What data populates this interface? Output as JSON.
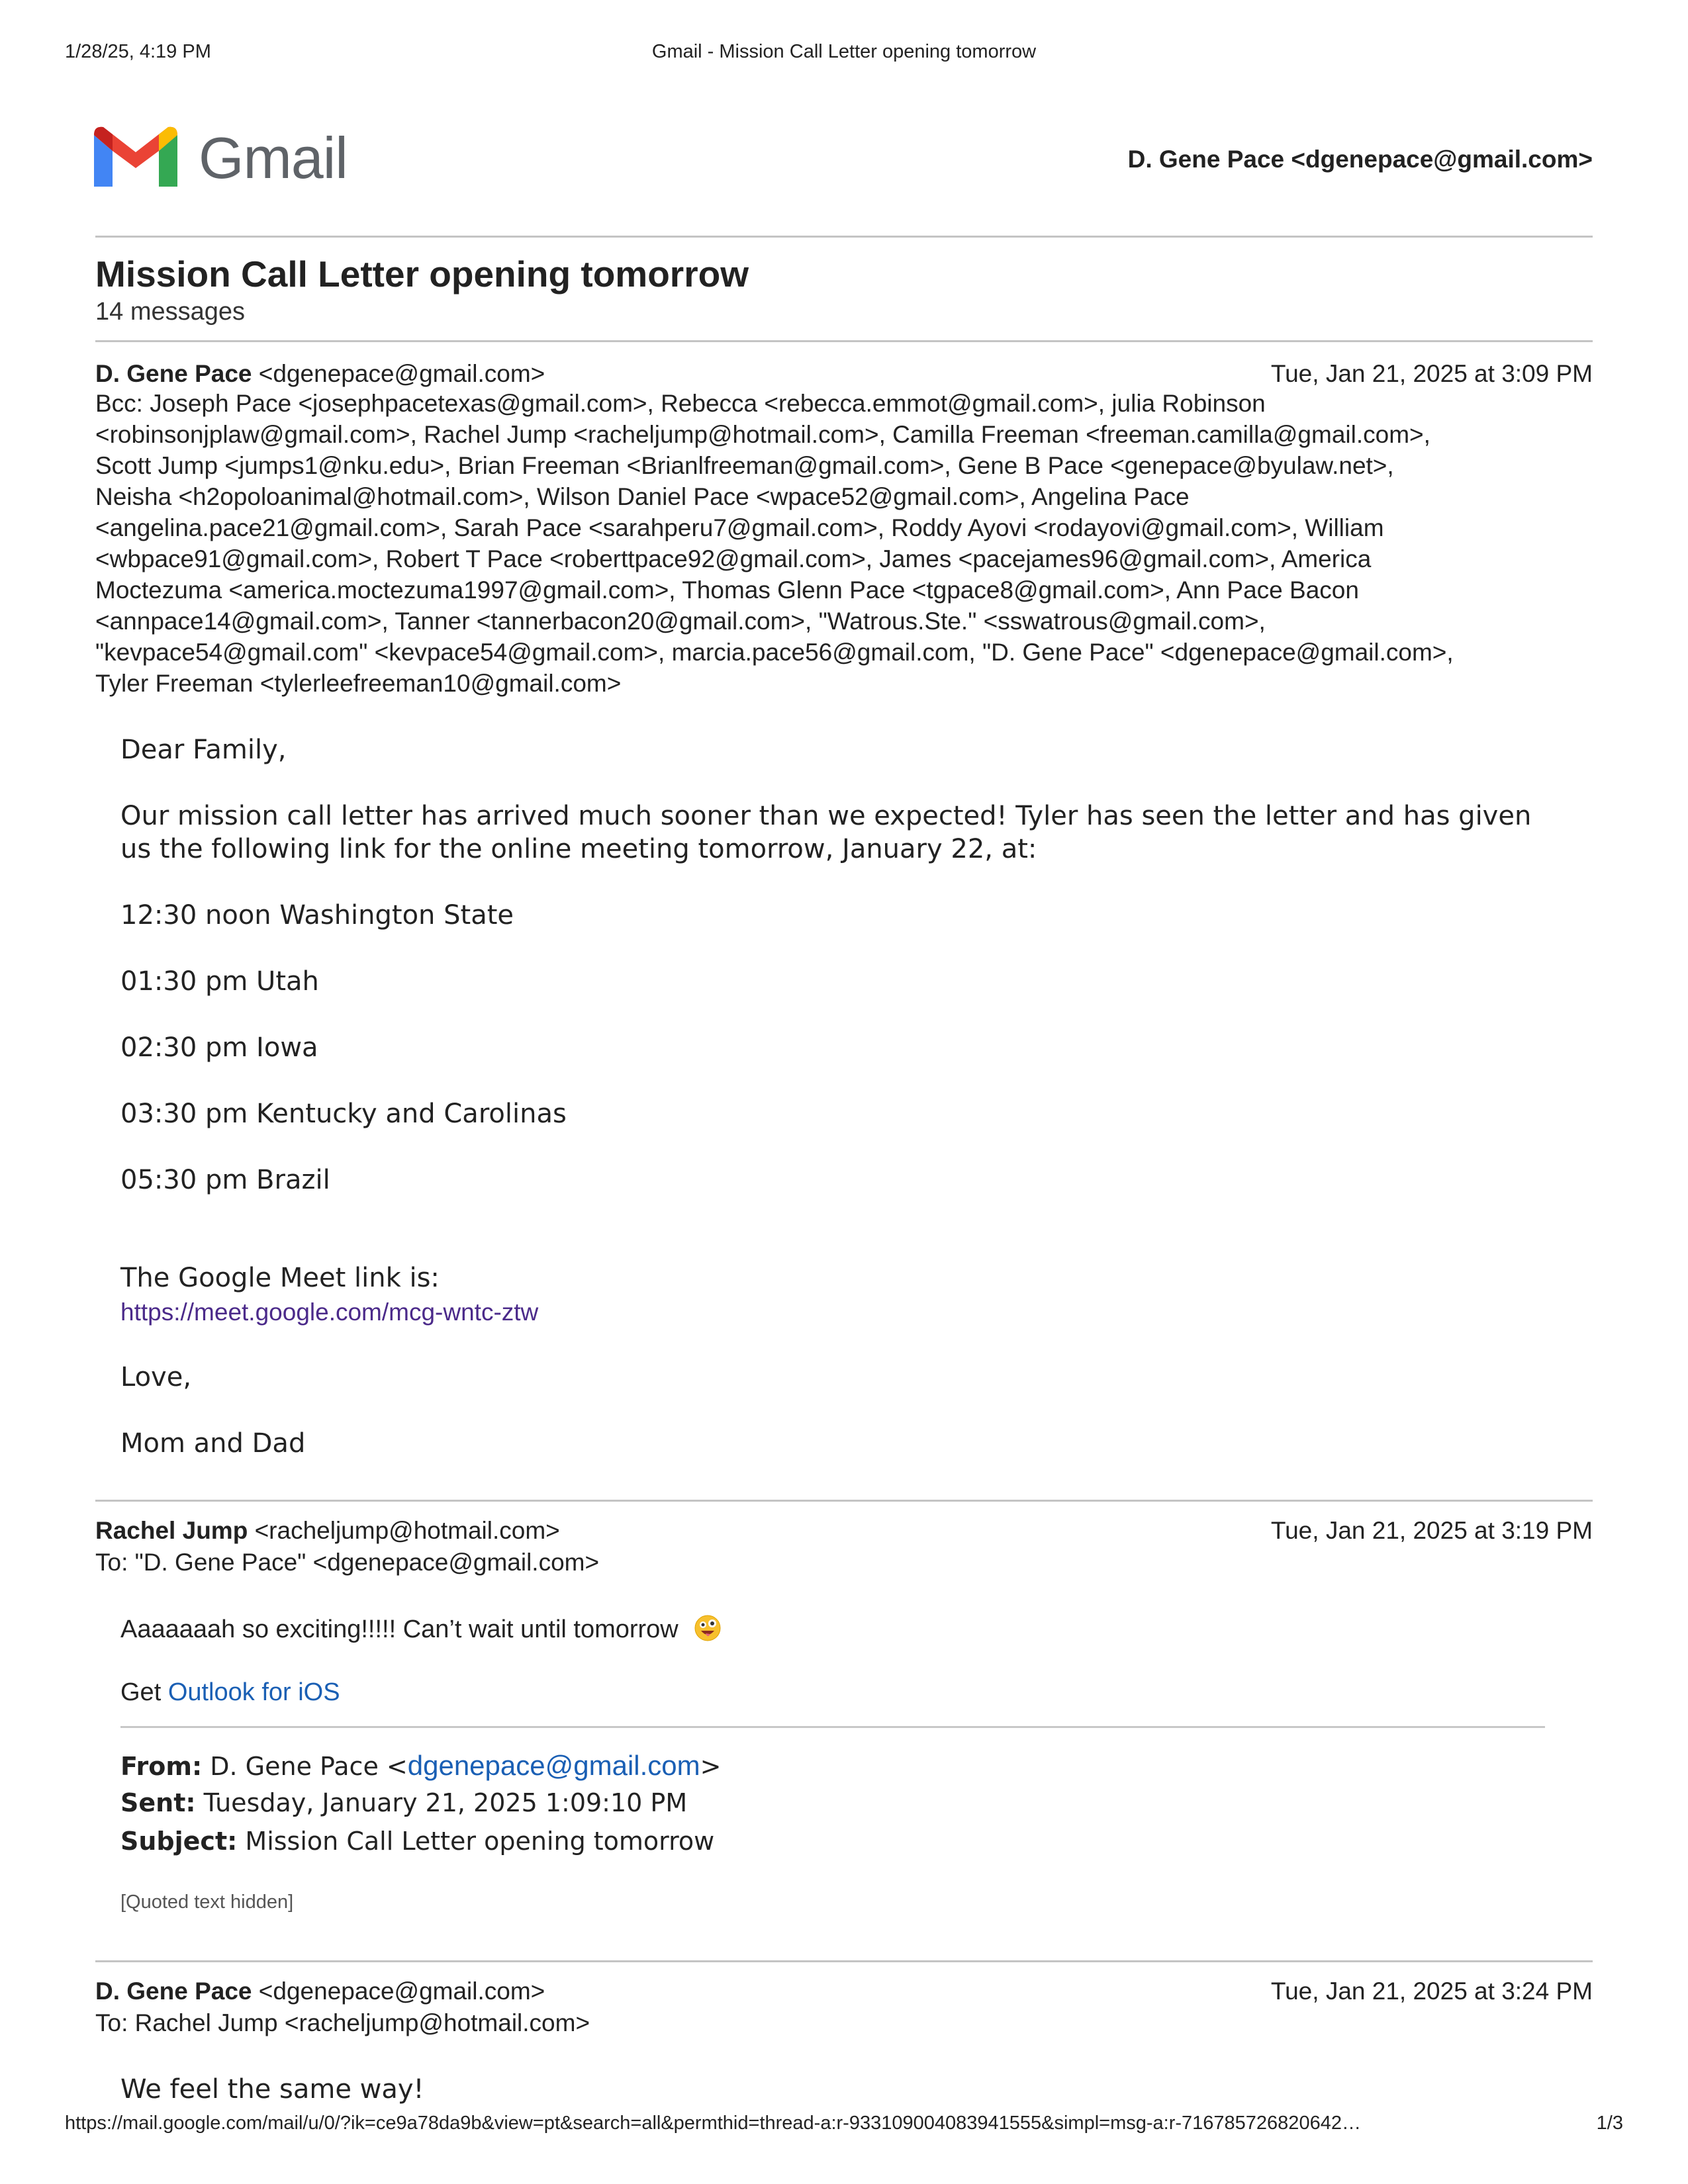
{
  "print_header": {
    "datetime": "1/28/25, 4:19 PM",
    "title": "Gmail - Mission Call Letter opening tomorrow"
  },
  "logo": {
    "text": "Gmail",
    "icon": "gmail-m-icon"
  },
  "account": "D. Gene Pace <dgenepace@gmail.com>",
  "thread": {
    "subject": "Mission Call Letter opening tomorrow",
    "count": "14 messages"
  },
  "messages": [
    {
      "from_name": "D. Gene Pace",
      "from_email": "<dgenepace@gmail.com>",
      "date": "Tue, Jan 21, 2025 at 3:09 PM",
      "recipient_lines": [
        "Bcc: Joseph Pace <josephpacetexas@gmail.com>, Rebecca <rebecca.emmot@gmail.com>, julia Robinson",
        "<robinsonjplaw@gmail.com>, Rachel Jump <racheljump@hotmail.com>, Camilla Freeman <freeman.camilla@gmail.com>,",
        "Scott Jump <jumps1@nku.edu>, Brian Freeman <Brianlfreeman@gmail.com>, Gene B Pace <genepace@byulaw.net>,",
        "Neisha <h2opoloanimal@hotmail.com>, Wilson Daniel Pace <wpace52@gmail.com>, Angelina Pace",
        "<angelina.pace21@gmail.com>, Sarah Pace <sarahperu7@gmail.com>, Roddy Ayovi <rodayovi@gmail.com>, William",
        "<wbpace91@gmail.com>, Robert T Pace <roberttpace92@gmail.com>, James <pacejames96@gmail.com>, America",
        "Moctezuma <america.moctezuma1997@gmail.com>, Thomas Glenn Pace <tgpace8@gmail.com>, Ann Pace Bacon",
        "<annpace14@gmail.com>, Tanner <tannerbacon20@gmail.com>, \"Watrous.Ste.\" <sswatrous@gmail.com>,",
        "\"kevpace54@gmail.com\" <kevpace54@gmail.com>, marcia.pace56@gmail.com, \"D. Gene Pace\" <dgenepace@gmail.com>,",
        "Tyler Freeman <tylerleefreeman10@gmail.com>"
      ],
      "greeting": "Dear Family,",
      "para1_line1": "Our mission call letter has arrived much sooner than we expected! Tyler has seen the letter and has given",
      "para1_line2": "us the following link for the online meeting tomorrow, January 22, at:",
      "times": [
        "12:30 noon Washington State",
        "01:30 pm Utah",
        "02:30 pm Iowa",
        "03:30 pm Kentucky and Carolinas",
        "05:30 pm Brazil"
      ],
      "meet_intro": "The Google Meet link is:",
      "meet_link": "https://meet.google.com/mcg-wntc-ztw",
      "closing": "Love,",
      "signature": "Mom and Dad"
    },
    {
      "from_name": "Rachel Jump",
      "from_email": "<racheljump@hotmail.com>",
      "date": "Tue, Jan 21, 2025 at 3:19 PM",
      "to_line": "To: \"D. Gene Pace\" <dgenepace@gmail.com>",
      "body": "Aaaaaaah so exciting!!!!! Can’t wait until tomorrow",
      "get_prefix": "Get ",
      "get_link": "Outlook for iOS",
      "quoted": {
        "from_label": "From:",
        "from_name": "D. Gene Pace <",
        "from_email": "dgenepace@gmail.com",
        "from_close": ">",
        "sent_label": "Sent:",
        "sent_value": "Tuesday, January 21, 2025 1:09:10 PM",
        "subject_label": "Subject:",
        "subject_value": "Mission Call Letter opening tomorrow"
      },
      "hidden_note": "[Quoted text hidden]"
    },
    {
      "from_name": "D. Gene Pace",
      "from_email": "<dgenepace@gmail.com>",
      "date": "Tue, Jan 21, 2025 at 3:24 PM",
      "to_line": "To: Rachel Jump <racheljump@hotmail.com>",
      "body": "We feel the same way!"
    }
  ],
  "print_footer": {
    "url": "https://mail.google.com/mail/u/0/?ik=ce9a78da9b&view=pt&search=all&permthid=thread-a:r-933109004083941555&simpl=msg-a:r-716785726820642…",
    "page": "1/3"
  }
}
